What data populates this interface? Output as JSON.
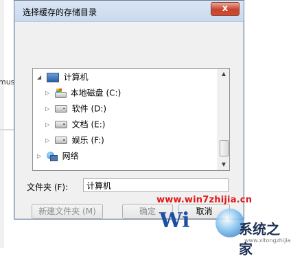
{
  "background": {
    "partial_text": "musi"
  },
  "dialog": {
    "title": "选择缓存的存储目录",
    "close_label": "x"
  },
  "tree": {
    "items": [
      {
        "label": "计算机",
        "icon": "computer-icon",
        "expander": "◢"
      },
      {
        "label": "本地磁盘 (C:)",
        "icon": "system-drive-icon",
        "expander": "▷"
      },
      {
        "label": "软件 (D:)",
        "icon": "drive-icon",
        "expander": "▷"
      },
      {
        "label": "文档 (E:)",
        "icon": "drive-icon",
        "expander": "▷"
      },
      {
        "label": "娱乐 (F:)",
        "icon": "drive-icon",
        "expander": "▷"
      },
      {
        "label": "网络",
        "icon": "network-icon",
        "expander": "▷"
      }
    ],
    "scroll_up": "▲",
    "scroll_down": "▼"
  },
  "folder": {
    "label": "文件夹 (F):",
    "value": "计算机"
  },
  "buttons": {
    "new_folder": "新建文件夹 (M)",
    "ok": "确定",
    "cancel": "取消"
  },
  "watermark": {
    "url": "www.win7zhijia.cn",
    "logo_letters": "Wi",
    "logo_text": "系统之家",
    "logo_small": "www.xitongzhijia.net"
  },
  "colors": {
    "watermark_url": "#e01818",
    "title_bar": "#c9d9ee"
  }
}
